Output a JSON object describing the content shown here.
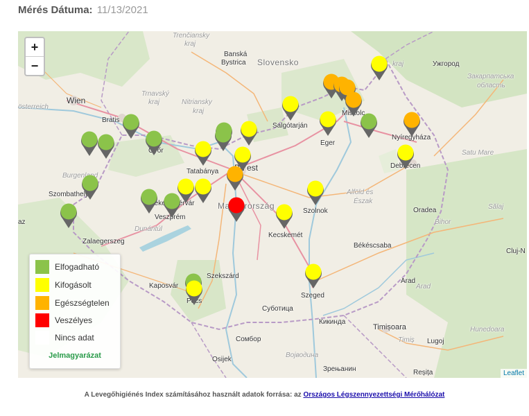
{
  "header": {
    "date_label": "Mérés Dátuma:",
    "date_value": "11/13/2021"
  },
  "map": {
    "zoom_in": "+",
    "zoom_out": "−",
    "attribution": "Leaflet",
    "labels": {
      "slovensko": "Slovensko",
      "madarorszag": "Magyarország",
      "trenciansky": "Trenčiansky",
      "kraj1": "kraj",
      "banska": "Banská",
      "bystrica": "Bystrica",
      "trnavsky": "Trnavský",
      "kraj2": "kraj",
      "nitriansky": "Nitriansky",
      "kraj3": "kraj",
      "kraj4": "kraj",
      "osterreich": "österreich",
      "wien": "Wien",
      "bratislava": "Bratis",
      "gyor": "Győr",
      "tatabanya": "Tatabánya",
      "budapest": "Bu   est",
      "salgotarjan": "Salgótarján",
      "eger": "Eger",
      "miskolc": "Miskolc",
      "nyiregyhaza": "Nyíregyháza",
      "debrecen": "Debrecen",
      "uzhgorod": "Ужгород",
      "zakarpatska": "Закарпатська",
      "oblast": "область",
      "satu_mare": "Satu Mare",
      "szombathely": "Szombathely",
      "szekesfehervar": "Székesfehérvár",
      "veszprem": "Veszprém",
      "dunantul": "Dunántúl",
      "burgenland": "Burgenland",
      "zalaegerszeg": "Zalaegerszeg",
      "szolnok": "Szolnok",
      "alfold1": "Alföld és",
      "alfold2": "Észak",
      "kecskemet": "Kecskemét",
      "oradea": "Oradea",
      "bihor": "Bihor",
      "salaj": "Sălaj",
      "bekescsaba": "Békéscsaba",
      "cluj": "Cluj-N",
      "kaposvar": "Kaposvár",
      "szekszard": "Szekszárd",
      "pecs": "Pécs",
      "szeged": "Szeged",
      "subotica": "Суботица",
      "kikinda": "Кикинда",
      "timisoara": "Timișoara",
      "timis": "Timiș",
      "arad1": "Arad",
      "arad2": "Arad",
      "lugoj": "Lugoj",
      "hunedoara": "Hunedoara",
      "sombor": "Сомбор",
      "osijek": "Osijek",
      "vojvodina": "Војводина",
      "zrenjanin": "Зрењанин",
      "resita": "Reșița",
      "az": "az"
    }
  },
  "legend": {
    "items": [
      {
        "label": "Elfogadható",
        "color": "#8bc34a"
      },
      {
        "label": "Kifogásolt",
        "color": "#ffff00"
      },
      {
        "label": "Egészségtelen",
        "color": "#ffb300"
      },
      {
        "label": "Veszélyes",
        "color": "#ff0000"
      },
      {
        "label": "Nincs adat",
        "color": "#ffffff"
      }
    ],
    "title": "Jelmagyarázat"
  },
  "markers": [
    {
      "category": 0,
      "color": "#8bc34a"
    },
    {
      "category": 0,
      "color": "#8bc34a"
    },
    {
      "category": 0,
      "color": "#8bc34a"
    },
    {
      "category": 0,
      "color": "#8bc34a"
    },
    {
      "category": 0,
      "color": "#8bc34a"
    },
    {
      "category": 0,
      "color": "#8bc34a"
    },
    {
      "category": 0,
      "color": "#8bc34a"
    },
    {
      "category": 0,
      "color": "#8bc34a"
    },
    {
      "category": 0,
      "color": "#8bc34a"
    },
    {
      "category": 0,
      "color": "#8bc34a"
    },
    {
      "category": 0,
      "color": "#8bc34a"
    },
    {
      "category": 0,
      "color": "#8bc34a"
    },
    {
      "category": 1,
      "color": "#ffff00"
    },
    {
      "category": 1,
      "color": "#ffff00"
    },
    {
      "category": 1,
      "color": "#ffff00"
    },
    {
      "category": 1,
      "color": "#ffff00"
    },
    {
      "category": 1,
      "color": "#ffff00"
    },
    {
      "category": 1,
      "color": "#ffff00"
    },
    {
      "category": 1,
      "color": "#ffff00"
    },
    {
      "category": 1,
      "color": "#ffff00"
    },
    {
      "category": 1,
      "color": "#ffff00"
    },
    {
      "category": 1,
      "color": "#ffff00"
    },
    {
      "category": 1,
      "color": "#ffff00"
    },
    {
      "category": 1,
      "color": "#ffff00"
    },
    {
      "category": 1,
      "color": "#ffff00"
    },
    {
      "category": 2,
      "color": "#ffb300"
    },
    {
      "category": 2,
      "color": "#ffb300"
    },
    {
      "category": 2,
      "color": "#ffb300"
    },
    {
      "category": 2,
      "color": "#ffb300"
    },
    {
      "category": 2,
      "color": "#ffb300"
    },
    {
      "category": 2,
      "color": "#ffb300"
    },
    {
      "category": 3,
      "color": "#ff0000"
    }
  ],
  "footer": {
    "text": "A Levegőhigiénés Index számításához használt adatok forrása: az",
    "link": "Országos Légszennyezettségi Mérőhálózat"
  }
}
